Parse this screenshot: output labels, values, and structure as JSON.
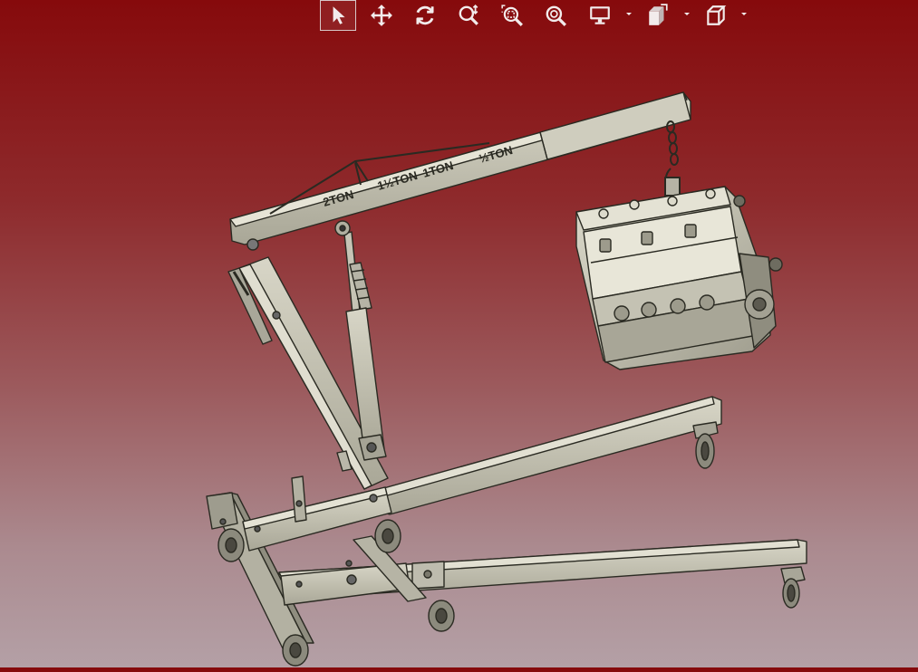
{
  "app": {
    "window": "CAD 3D model viewer",
    "background_top": "#860a0c",
    "background_bottom": "#b4a0a6",
    "model_color": "#c9c7b7",
    "edge_color": "#2a2a22"
  },
  "toolbar": {
    "buttons": [
      {
        "id": "select",
        "icon": "cursor-arrow-icon",
        "active": true
      },
      {
        "id": "pan",
        "icon": "move-arrows-icon",
        "active": false
      },
      {
        "id": "rotate",
        "icon": "rotate-icon",
        "active": false
      },
      {
        "id": "zoom-area",
        "icon": "zoom-interactive-icon",
        "active": false
      },
      {
        "id": "zoom-box",
        "icon": "zoom-box-icon",
        "active": false
      },
      {
        "id": "zoom-fit",
        "icon": "zoom-fit-icon",
        "active": false
      },
      {
        "id": "display",
        "icon": "monitor-icon",
        "has_dropdown": true
      },
      {
        "id": "views",
        "icon": "views-icon",
        "has_dropdown": true
      },
      {
        "id": "view-cube",
        "icon": "cube-icon",
        "has_dropdown": true
      }
    ]
  },
  "model": {
    "boom_labels": [
      "2TON",
      "1½TON",
      "1TON",
      "½TON"
    ]
  }
}
